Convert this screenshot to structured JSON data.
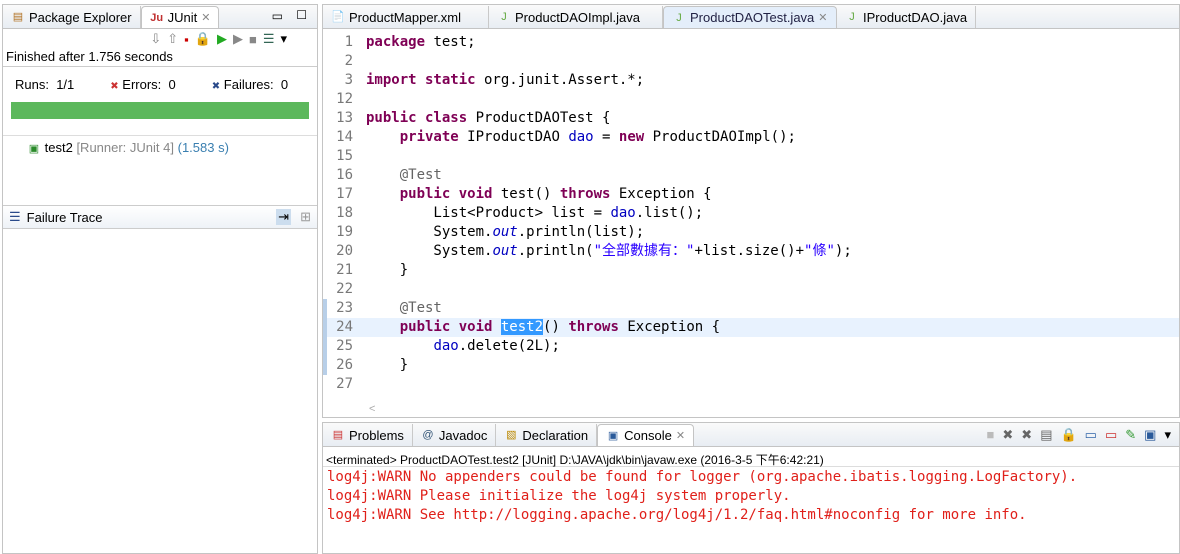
{
  "left": {
    "tabs": [
      {
        "label": "Package Explorer"
      },
      {
        "label": "JUnit"
      }
    ],
    "status": "Finished after 1.756 seconds",
    "runs_label": "Runs:",
    "runs": "1/1",
    "errors_label": "Errors:",
    "errors": "0",
    "failures_label": "Failures:",
    "failures": "0",
    "progress_percent": 100,
    "progress_color": "#5cb85c",
    "test": {
      "name": "test2",
      "runner": "[Runner: JUnit 4]",
      "time": "(1.583 s)"
    },
    "failure_trace": "Failure Trace"
  },
  "editor": {
    "tabs": [
      {
        "label": "ProductMapper.xml"
      },
      {
        "label": "ProductDAOImpl.java"
      },
      {
        "label": "ProductDAOTest.java"
      },
      {
        "label": "IProductDAO.java"
      }
    ],
    "lines": [
      {
        "n": "1",
        "s": [
          [
            "package",
            "kw"
          ],
          [
            " test;",
            ""
          ]
        ]
      },
      {
        "n": "2",
        "s": []
      },
      {
        "n": "3",
        "s": [
          [
            "import static",
            "kw"
          ],
          [
            " org.junit.Assert.*;",
            ""
          ]
        ]
      },
      {
        "n": "12",
        "s": []
      },
      {
        "n": "13",
        "s": [
          [
            "public class",
            "kw"
          ],
          [
            " ProductDAOTest {",
            ""
          ]
        ]
      },
      {
        "n": "14",
        "s": [
          [
            "    ",
            ""
          ],
          [
            "private",
            "kw"
          ],
          [
            " IProductDAO ",
            ""
          ],
          [
            "dao",
            "fld"
          ],
          [
            " = ",
            ""
          ],
          [
            "new",
            "kw"
          ],
          [
            " ProductDAOImpl();",
            ""
          ]
        ]
      },
      {
        "n": "15",
        "s": []
      },
      {
        "n": "16",
        "s": [
          [
            "    @Test",
            "ann"
          ]
        ]
      },
      {
        "n": "17",
        "s": [
          [
            "    ",
            ""
          ],
          [
            "public void",
            "kw"
          ],
          [
            " test() ",
            ""
          ],
          [
            "throws",
            "kw"
          ],
          [
            " Exception {",
            ""
          ]
        ]
      },
      {
        "n": "18",
        "s": [
          [
            "        List<Product> list = ",
            ""
          ],
          [
            "dao",
            "fld"
          ],
          [
            ".list();",
            ""
          ]
        ]
      },
      {
        "n": "19",
        "s": [
          [
            "        System.",
            ""
          ],
          [
            "out",
            "it"
          ],
          [
            ".println(list);",
            ""
          ]
        ]
      },
      {
        "n": "20",
        "s": [
          [
            "        System.",
            ""
          ],
          [
            "out",
            "it"
          ],
          [
            ".println(",
            ""
          ],
          [
            "\"全部數據有：\"",
            "str"
          ],
          [
            "+list.size()+",
            ""
          ],
          [
            "\"條\"",
            "str"
          ],
          [
            ");",
            ""
          ]
        ]
      },
      {
        "n": "21",
        "s": [
          [
            "    }",
            ""
          ]
        ]
      },
      {
        "n": "22",
        "s": []
      },
      {
        "n": "23",
        "s": [
          [
            "    @Test",
            "ann"
          ]
        ]
      },
      {
        "n": "24",
        "s": [
          [
            "    ",
            ""
          ],
          [
            "public void",
            "kw"
          ],
          [
            " ",
            ""
          ],
          [
            "test2",
            "sel"
          ],
          [
            "() ",
            ""
          ],
          [
            "throws",
            "kw"
          ],
          [
            " Exception {",
            ""
          ]
        ]
      },
      {
        "n": "25",
        "s": [
          [
            "        ",
            ""
          ],
          [
            "dao",
            "fld"
          ],
          [
            ".delete(2L);",
            ""
          ]
        ]
      },
      {
        "n": "26",
        "s": [
          [
            "    }",
            ""
          ]
        ]
      },
      {
        "n": "27",
        "s": []
      }
    ]
  },
  "bottom": {
    "tabs": [
      {
        "label": "Problems"
      },
      {
        "label": "Javadoc"
      },
      {
        "label": "Declaration"
      },
      {
        "label": "Console"
      }
    ],
    "console_header": "<terminated> ProductDAOTest.test2 [JUnit] D:\\JAVA\\jdk\\bin\\javaw.exe (2016-3-5 下午6:42:21)",
    "log": [
      "log4j:WARN No appenders could be found for logger (org.apache.ibatis.logging.LogFactory).",
      "log4j:WARN Please initialize the log4j system properly.",
      "log4j:WARN See http://logging.apache.org/log4j/1.2/faq.html#noconfig for more info."
    ]
  }
}
